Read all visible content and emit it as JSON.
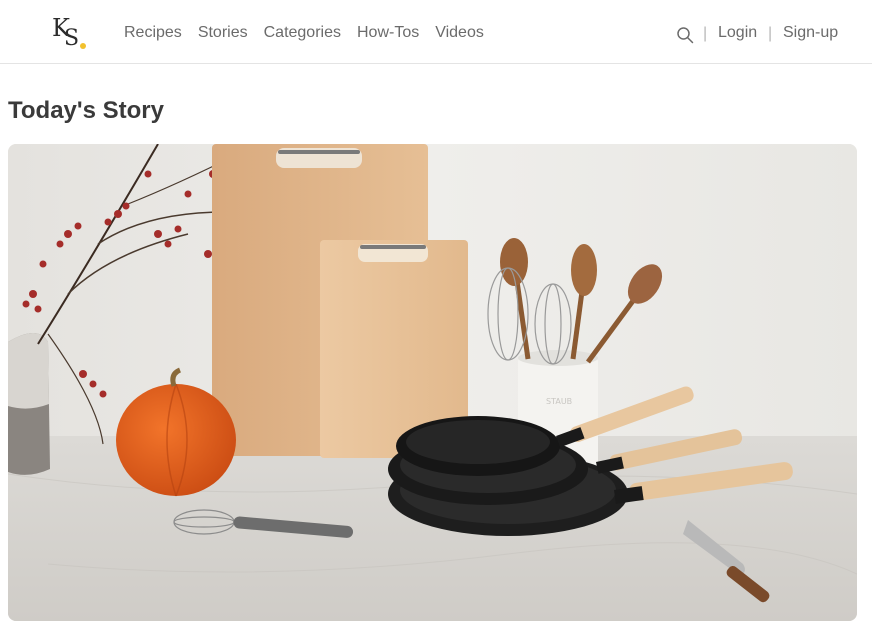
{
  "brand": {
    "logo_text_1": "K",
    "logo_text_2": "S"
  },
  "nav": {
    "items": [
      "Recipes",
      "Stories",
      "Categories",
      "How-Tos",
      "Videos"
    ]
  },
  "account": {
    "separator": "|",
    "login": "Login",
    "signup": "Sign-up"
  },
  "main": {
    "section_title": "Today's Story"
  },
  "colors": {
    "accent_dot": "#f2c12e",
    "nav_text": "#6b6b6b",
    "divider": "#e4e4e4"
  }
}
